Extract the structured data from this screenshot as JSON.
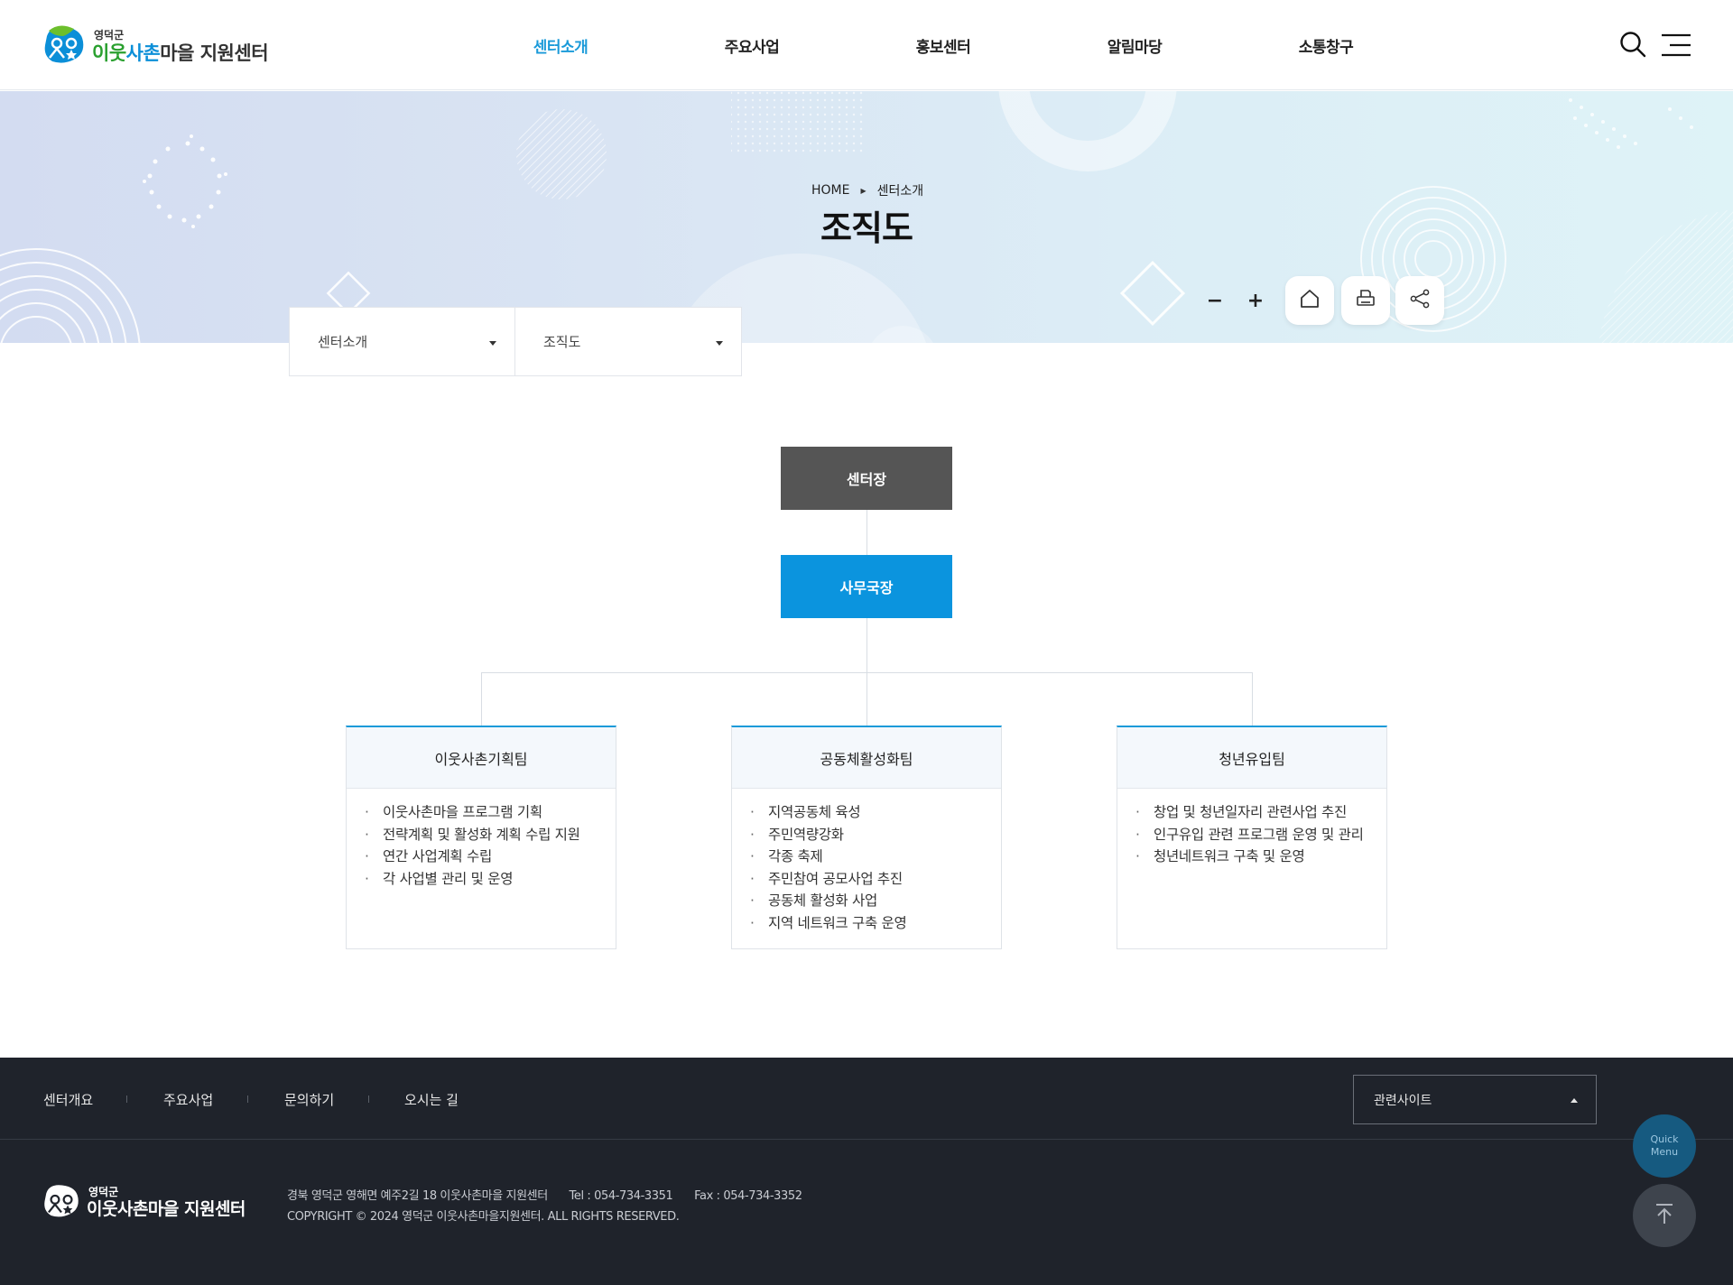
{
  "site": {
    "logo_small": "영덕군",
    "logo_part1": "이웃",
    "logo_part2": "사촌",
    "logo_part3": "마을 지원센터"
  },
  "nav": {
    "items": [
      {
        "label": "센터소개",
        "active": true
      },
      {
        "label": "주요사업",
        "active": false
      },
      {
        "label": "홍보센터",
        "active": false
      },
      {
        "label": "알림마당",
        "active": false
      },
      {
        "label": "소통창구",
        "active": false
      }
    ]
  },
  "icons": {
    "search": "search-icon",
    "menu": "hamburger-menu-icon",
    "home": "home-icon",
    "print": "print-icon",
    "share": "share-icon",
    "top": "arrow-up-icon"
  },
  "colors": {
    "accent": "#1a9ad9",
    "director_box": "#555555",
    "secretary_box": "#0b94de",
    "footer_bg": "#1f232b"
  },
  "breadcrumb": {
    "home": "HOME",
    "current": "센터소개"
  },
  "page": {
    "title": "조직도"
  },
  "tools": {
    "zoom_out": "−",
    "zoom_in": "+"
  },
  "subnav": {
    "depth1": "센터소개",
    "depth2": "조직도"
  },
  "org": {
    "director": "센터장",
    "secretary": "사무국장",
    "teams": [
      {
        "name": "이웃사촌기획팀",
        "duties": [
          "이웃사촌마을 프로그램 기획",
          "전략계획 및 활성화 계획 수립 지원",
          "연간 사업계획 수립",
          "각 사업별 관리 및 운영"
        ]
      },
      {
        "name": "공동체활성화팀",
        "duties": [
          "지역공동체 육성",
          "주민역량강화",
          "각종 축제",
          "주민참여 공모사업 추진",
          "공동체 활성화 사업",
          "지역 네트워크 구축 운영"
        ]
      },
      {
        "name": "청년유입팀",
        "duties": [
          "창업 및 청년일자리 관련사업 추진",
          "인구유입 관련 프로그램 운영 및 관리",
          "청년네트워크 구축 및 운영"
        ]
      }
    ]
  },
  "footer": {
    "menu": [
      "센터개요",
      "주요사업",
      "문의하기",
      "오시는 길"
    ],
    "related_sites": "관련사이트",
    "logo_small": "영덕군",
    "logo_main": "이웃사촌마을 지원센터",
    "address": "경북 영덕군 영해면 예주2길 18 이웃사촌마을 지원센터",
    "tel": "Tel : 054-734-3351",
    "fax": "Fax : 054-734-3352",
    "copyright": "COPYRIGHT © 2024 영덕군 이웃사촌마을지원센터. ALL RIGHTS RESERVED."
  },
  "quick_menu": {
    "line1": "Quick",
    "line2": "Menu"
  }
}
